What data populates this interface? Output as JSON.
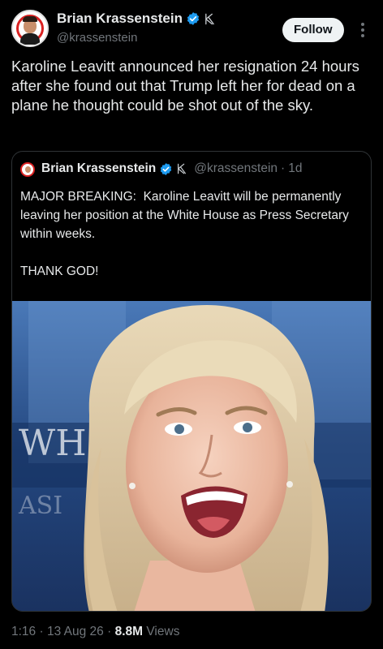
{
  "author": {
    "name": "Brian Krassenstein",
    "handle": "@krassenstein",
    "verified_color": "#1d9bf0"
  },
  "follow_label": "Follow",
  "tweet_text": "Karoline Leavitt announced her resignation 24 hours after she found out that Trump left her for dead on a plane he thought could be shot out of the sky.",
  "quote": {
    "name": "Brian Krassenstein",
    "handle": "@krassenstein",
    "separator": "·",
    "time": "1d",
    "text": "MAJOR BREAKING:  Karoline Leavitt will be permanently leaving her position at the White House as Press Secretary within weeks.\n\nTHANK GOD!"
  },
  "meta": {
    "time": "1:16",
    "sep1": "·",
    "date": "13 Aug 26",
    "sep2": "·",
    "views_count": "8.8M",
    "views_label": "Views"
  }
}
